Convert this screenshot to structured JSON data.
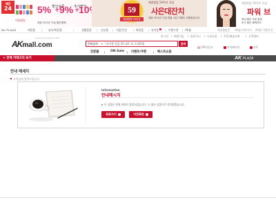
{
  "banner": {
    "badge_top": "매장",
    "badge_num": "24",
    "left_note": "이달말일",
    "pct1": "5%",
    "pct1_label": "할인쿠폰",
    "pct2": "9%",
    "pct2_label": "추가할인",
    "pct3": "10%",
    "pct3_label": "적립",
    "left_sub1": "애경 59주년 기념 할인혜택!",
    "center_59": "59",
    "center_ribbon": "애경창립 59주년",
    "center_tag": "애경창립 59주년 기념",
    "center_title": "사은대잔치",
    "center_sub": "애경 59주년 기념 특별 사은 이벤트 진행중입니다",
    "right_tag": "애경창립 59주년 기념",
    "right_title": "파워 브",
    "right_sub1": "최대 할인 쿠폰 증정",
    "right_sub2": "추가 할인 혜택까지"
  },
  "catrow": {
    "brand": "AK",
    "brand_sub": "PLAZA",
    "items": [
      "애경몰",
      "뷰티/화장품",
      "생활용품",
      "신상품",
      "식품/건강",
      "화장품",
      "유아동",
      "브랜드관",
      "AK몰"
    ],
    "right_items": [
      "애경몰방문",
      "AK몰 바로가기",
      "AK몰 이용안내"
    ]
  },
  "util_links": [
    "로그인",
    "회원가입",
    "장바구니",
    "나의쇼핑",
    "주문/배송조회",
    "고객센터"
  ],
  "logo": {
    "ak": "AK",
    "mall": "mall.com",
    "tagline": "Aekyung Shopping Mall"
  },
  "search": {
    "scope": "전체검색",
    "placeholder": "유아용 반값 DC세트 초 3,000원",
    "button": "검색"
  },
  "right_links": [
    "VIP라운지",
    "마이페이지",
    "카트"
  ],
  "gnb": [
    "전문몰",
    "ON Sale",
    "이벤트/쿠폰",
    "베스트쇼핑"
  ],
  "category_bar": {
    "all_label": "+ 전체 카테고리 보기",
    "brand": "AK",
    "brand_sub": "PLAZA"
  },
  "page": {
    "title": "안내 메세지",
    "crumb": "고객님께 알려드립니다."
  },
  "info": {
    "eng": "Information",
    "kor": "안내메시지",
    "message": "이 상품은 현재 판매가 종료되었습니다. 더 좋은 상품으로 찾아뵙겠습니다.",
    "btn_back": "뒤로가기",
    "btn_prev": "이전화면"
  },
  "colors": {
    "accent": "#c8102e",
    "catbar": "#4b4b4b"
  }
}
